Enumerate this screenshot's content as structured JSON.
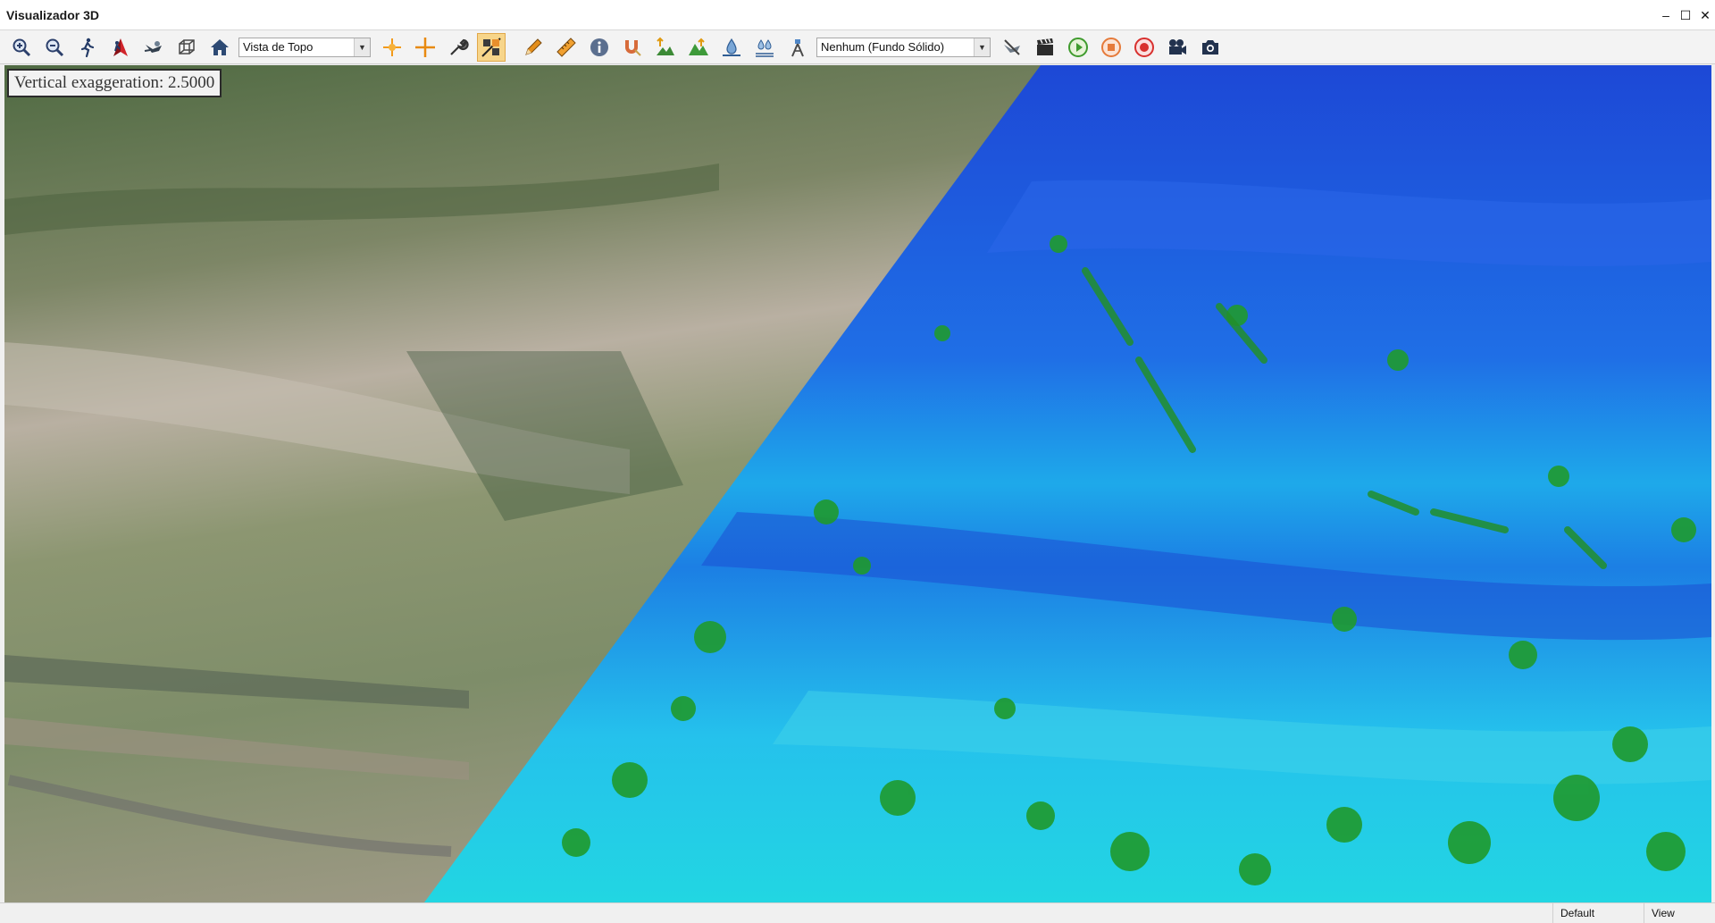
{
  "window": {
    "title": "Visualizador 3D",
    "controls": {
      "minimize": "–",
      "maximize": "☐",
      "close": "✕"
    }
  },
  "toolbar": {
    "view_select": {
      "value": "Vista de Topo"
    },
    "background_select": {
      "value": "Nenhum (Fundo Sólido)"
    },
    "icons": [
      "zoom-in-icon",
      "zoom-out-icon",
      "walk-icon",
      "fly-icon",
      "orbit-icon",
      "bounding-box-icon",
      "home-icon",
      "pick-point-icon",
      "crosshair-icon",
      "tools-icon",
      "toggle-overlay-icon",
      "pencil-icon",
      "ruler-icon",
      "info-icon",
      "magnet-icon",
      "elevation-up-icon",
      "terrain-peaks-icon",
      "water-level-icon",
      "flood-icon",
      "station-icon",
      "disable-flight-icon",
      "clapperboard-icon",
      "play-icon",
      "stop-icon",
      "record-icon",
      "video-camera-icon",
      "camera-icon"
    ],
    "active_icon": "toggle-overlay-icon"
  },
  "viewport": {
    "exaggeration_label": "Vertical exaggeration: 2.5000",
    "colors": {
      "satellite_base": "#8a8f72",
      "elevation_low": "#1aa7e8",
      "elevation_high": "#1e46d8",
      "vegetation": "#2fae2a"
    }
  },
  "statusbar": {
    "profile": "Default",
    "mode": "View"
  }
}
